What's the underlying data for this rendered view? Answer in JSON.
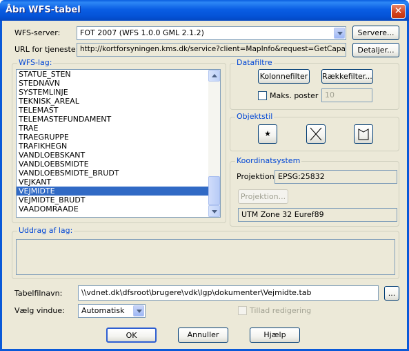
{
  "window": {
    "title": "Åbn WFS-tabel",
    "close_glyph": "✕"
  },
  "server": {
    "label": "WFS-server:",
    "value": "FOT 2007 (WFS 1.0.0 GML 2.1.2)",
    "button": "Servere..."
  },
  "url": {
    "label": "URL for tjeneste:",
    "value": "http://kortforsyningen.kms.dk/service?client=MapInfo&request=GetCapabilities&s",
    "button": "Detaljer..."
  },
  "wfs_layers": {
    "title": "WFS-lag:",
    "items": [
      "STATUE_STEN",
      "STEDNAVN",
      "SYSTEMLINJE",
      "TEKNISK_AREAL",
      "TELEMAST",
      "TELEMASTEFUNDAMENT",
      "TRAE",
      "TRAEGRUPPE",
      "TRAFIKHEGN",
      "VANDLOEBSKANT",
      "VANDLOEBSMIDTE",
      "VANDLOEBSMIDTE_BRUDT",
      "VEJKANT",
      "VEJMIDTE",
      "VEJMIDTE_BRUDT",
      "VAADOMRAADE"
    ],
    "selected": "VEJMIDTE"
  },
  "datafilters": {
    "title": "Datafiltre",
    "column_filter": "Kolonnefilter",
    "row_filter": "Rækkefilter...",
    "max_posts_label": "Maks. poster",
    "max_posts_value": "10"
  },
  "objectstyle": {
    "title": "Objektstil"
  },
  "coordsys": {
    "title": "Koordinatsystem",
    "projection_label": "Projektion:",
    "projection_value": "EPSG:25832",
    "projection_button": "Projektion...",
    "zone_value": "UTM Zone 32 Euref89"
  },
  "extract": {
    "title": "Uddrag af lag:"
  },
  "tablefile": {
    "label": "Tabelfilnavn:",
    "value": "\\\\vdnet.dk\\dfsroot\\brugere\\vdk\\lgp\\dokumenter\\Vejmidte.tab",
    "browse_label": "..."
  },
  "window_select": {
    "label": "Vælg vindue:",
    "value": "Automatisk",
    "allow_edit_label": "Tillad redigering"
  },
  "footer": {
    "ok": "OK",
    "cancel": "Annuller",
    "help": "Hjælp"
  }
}
